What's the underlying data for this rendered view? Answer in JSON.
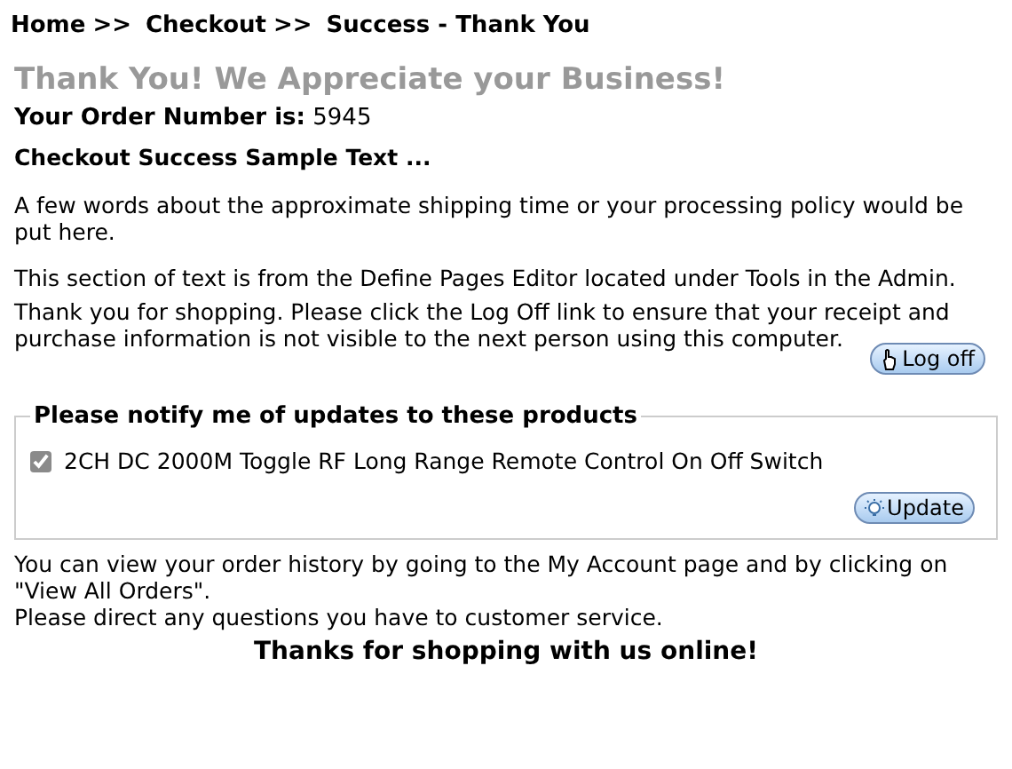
{
  "breadcrumb": [
    {
      "label": "Home",
      "separator": ">>"
    },
    {
      "label": "Checkout",
      "separator": ">>"
    },
    {
      "label": "Success - Thank You"
    }
  ],
  "heading": "Thank You! We Appreciate your Business!",
  "order_number": "**Your Order Number is:** 5945",
  "subheading": "Checkout Success Sample Text ...",
  "paragraphs": [
    "A few words about the approximate shipping time or your processing policy would be put here.",
    "This section of text is from the Define Pages Editor located under Tools in the Admin.",
    "Thank you for shopping. Please click the Log Off link to ensure that your receipt and purchase information is not visible to the next person using this computer."
  ],
  "logoff_button": "Log off",
  "notify": {
    "legend": "Please notify me of updates to these products",
    "products": [
      {
        "label": "2CH DC 2000M Toggle RF Long Range Remote Control On Off Switch",
        "checked": true
      }
    ],
    "button": "Update"
  },
  "footer_lines": [
    "You can view your order history by going to the My Account page and by clicking on \"View All Orders\".",
    "Please direct any questions you have to customer service."
  ],
  "closing": "Thanks for shopping with us online!"
}
